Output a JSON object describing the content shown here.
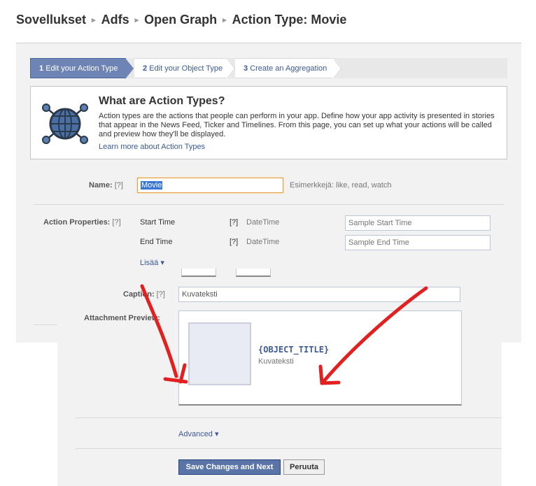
{
  "breadcrumb": {
    "items": [
      "Sovellukset",
      "Adfs",
      "Open Graph",
      "Action Type: Movie"
    ],
    "separator": "▸"
  },
  "steps": [
    {
      "num": "1",
      "label": "Edit your Action Type",
      "active": true
    },
    {
      "num": "2",
      "label": "Edit your Object Type",
      "active": false
    },
    {
      "num": "3",
      "label": "Create an Aggregation",
      "active": false
    }
  ],
  "info": {
    "icon": "globe-network-icon",
    "title": "What are Action Types?",
    "text": "Action types are the actions that people can perform in your app. Define how your app activity is presented in stories that appear in the News Feed, Ticker and Timelines. From this page, you can set up what your actions will be called and preview how they'll be displayed.",
    "link": "Learn more about Action Types"
  },
  "form": {
    "name_label": "Name:",
    "help": "[?]",
    "name_value": "Movie",
    "name_hint": "Esimerkkejä: like, read, watch",
    "props_label": "Action Properties:",
    "properties": [
      {
        "name": "Start Time",
        "help": "[?]",
        "type": "DateTime",
        "placeholder": "Sample Start Time"
      },
      {
        "name": "End Time",
        "help": "[?]",
        "type": "DateTime",
        "placeholder": "Sample End Time"
      }
    ],
    "more_link": "Lisää ▾",
    "caption_label": "Caption:",
    "caption_value": "Kuvateksti",
    "preview_label": "Attachment Preview:",
    "preview_title": "{OBJECT_TITLE}",
    "preview_caption": "Kuvateksti",
    "advanced_link": "Advanced ▾"
  },
  "buttons": {
    "save": "Save Changes and Next",
    "cancel": "Peruuta"
  },
  "colors": {
    "accent": "#3b5998",
    "active_step": "#6d84b4",
    "arrow_annotation": "#e32020"
  }
}
